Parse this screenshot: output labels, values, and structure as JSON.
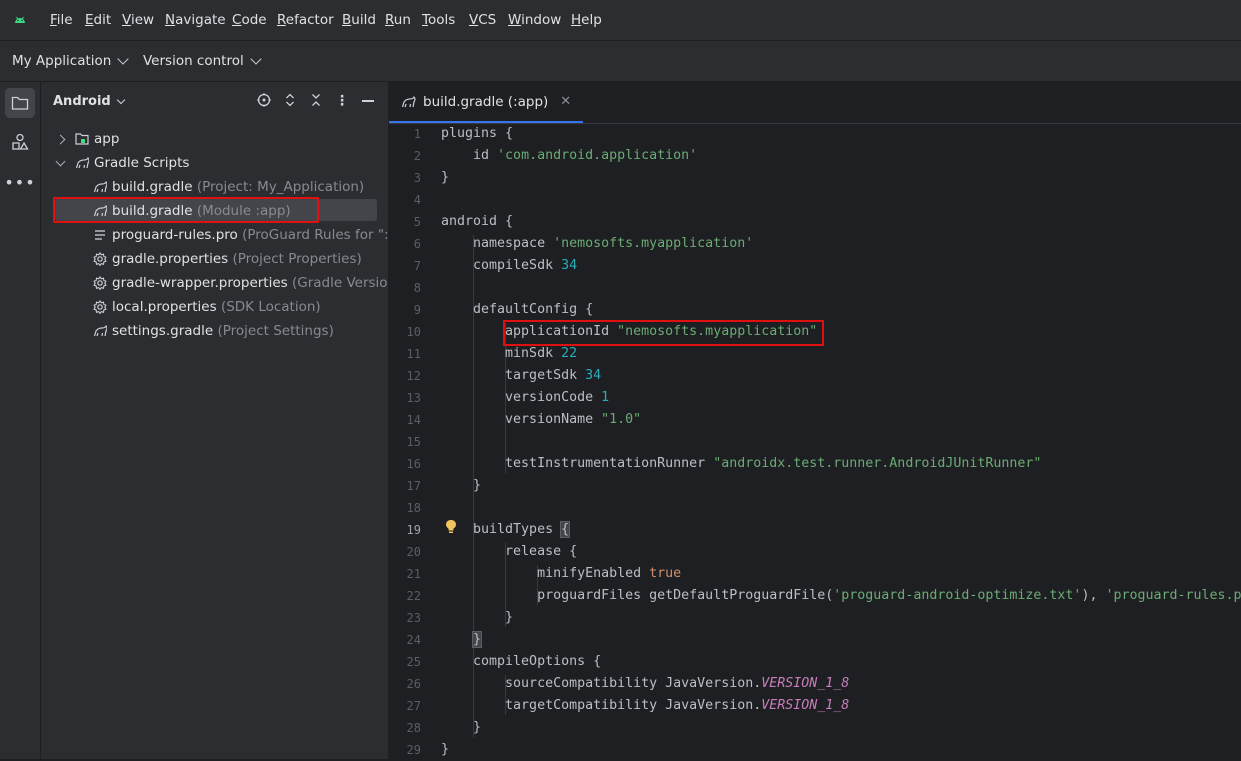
{
  "menu": {
    "items": [
      {
        "label": "File",
        "mnemonic": "F",
        "rest": "ile"
      },
      {
        "label": "Edit",
        "mnemonic": "E",
        "rest": "dit"
      },
      {
        "label": "View",
        "mnemonic": "V",
        "rest": "iew"
      },
      {
        "label": "Navigate",
        "mnemonic": "N",
        "rest": "avigate"
      },
      {
        "label": "Code",
        "mnemonic": "C",
        "rest": "ode"
      },
      {
        "label": "Refactor",
        "mnemonic": "R",
        "rest": "efactor"
      },
      {
        "label": "Build",
        "mnemonic": "B",
        "rest": "uild"
      },
      {
        "label": "Run",
        "mnemonic": "R",
        "rest": "un"
      },
      {
        "label": "Tools",
        "mnemonic": "T",
        "rest": "ools"
      },
      {
        "label": "VCS",
        "mnemonic": "V",
        "rest": "CS"
      },
      {
        "label": "Window",
        "mnemonic": "W",
        "rest": "indow"
      },
      {
        "label": "Help",
        "mnemonic": "H",
        "rest": "elp"
      }
    ]
  },
  "toolbar": {
    "project_name": "My Application",
    "vcs_label": "Version control"
  },
  "project_panel": {
    "view_mode": "Android",
    "tree": [
      {
        "name": "app",
        "hint": "",
        "icon": "folder-icon",
        "expanded": false,
        "level": 0
      },
      {
        "name": "Gradle Scripts",
        "hint": "",
        "icon": "gradle-icon",
        "expanded": true,
        "level": 0
      },
      {
        "name": "build.gradle",
        "hint": "(Project: My_Application)",
        "icon": "gradle-icon",
        "level": 1
      },
      {
        "name": "build.gradle",
        "hint": "(Module :app)",
        "icon": "gradle-icon",
        "level": 1,
        "selected": true
      },
      {
        "name": "proguard-rules.pro",
        "hint": "(ProGuard Rules for \":app\")",
        "icon": "text-file-icon",
        "level": 1
      },
      {
        "name": "gradle.properties",
        "hint": "(Project Properties)",
        "icon": "settings-file-icon",
        "level": 1
      },
      {
        "name": "gradle-wrapper.properties",
        "hint": "(Gradle Version)",
        "icon": "settings-file-icon",
        "level": 1
      },
      {
        "name": "local.properties",
        "hint": "(SDK Location)",
        "icon": "settings-file-icon",
        "level": 1
      },
      {
        "name": "settings.gradle",
        "hint": "(Project Settings)",
        "icon": "gradle-icon",
        "level": 1
      }
    ]
  },
  "editor": {
    "tab_label": "build.gradle (:app)",
    "current_line": 19,
    "lines": [
      "plugins {",
      "    id 'com.android.application'",
      "}",
      "",
      "android {",
      "    namespace 'nemosofts.myapplication'",
      "    compileSdk 34",
      "",
      "    defaultConfig {",
      "        applicationId \"nemosofts.myapplication\"",
      "        minSdk 22",
      "        targetSdk 34",
      "        versionCode 1",
      "        versionName \"1.0\"",
      "",
      "        testInstrumentationRunner \"androidx.test.runner.AndroidJUnitRunner\"",
      "    }",
      "",
      "    buildTypes {",
      "        release {",
      "            minifyEnabled true",
      "            proguardFiles getDefaultProguardFile('proguard-android-optimize.txt'), 'proguard-rules.pro'",
      "        }",
      "    }",
      "    compileOptions {",
      "        sourceCompatibility JavaVersion.VERSION_1_8",
      "        targetCompatibility JavaVersion.VERSION_1_8",
      "    }",
      "}"
    ]
  },
  "colors": {
    "accent": "#3574f0",
    "highlight_box": "#e01010",
    "string": "#6aab73",
    "number": "#2aacb8",
    "keyword": "#cf8e6d",
    "constant": "#c77dbb"
  }
}
